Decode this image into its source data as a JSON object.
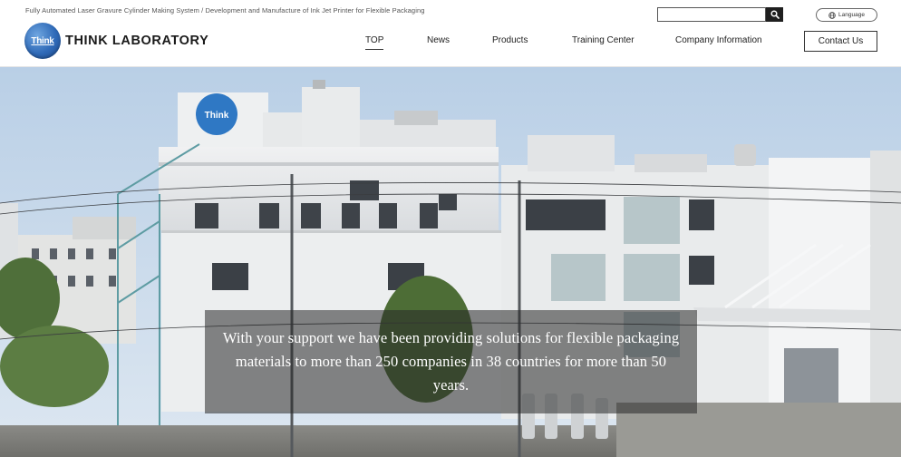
{
  "header": {
    "tagline": "Fully Automated Laser Gravure Cylinder Making System / Development and Manufacture of Ink Jet Printer for Flexible Packaging",
    "logo_badge_text": "Think",
    "logo_text": "THINK LABORATORY",
    "search": {
      "value": "",
      "placeholder": "",
      "button_icon": "search-icon"
    },
    "language_label": "Language",
    "language_icon": "globe-icon",
    "nav": [
      {
        "label": "TOP",
        "active": true
      },
      {
        "label": "News",
        "active": false
      },
      {
        "label": "Products",
        "active": false
      },
      {
        "label": "Training Center",
        "active": false
      },
      {
        "label": "Company Information",
        "active": false
      }
    ],
    "contact_label": "Contact Us"
  },
  "hero": {
    "building_sign_text": "Think",
    "caption": "With your support we have been providing solutions for flexible packaging materials to more than 250 companies in 38 countries for more than 50 years."
  },
  "colors": {
    "brand_blue": "#2f6ab8",
    "sky": "#c9d9ea",
    "building": "#e8eaec",
    "caption_overlay": "rgba(40,40,40,0.55)"
  }
}
